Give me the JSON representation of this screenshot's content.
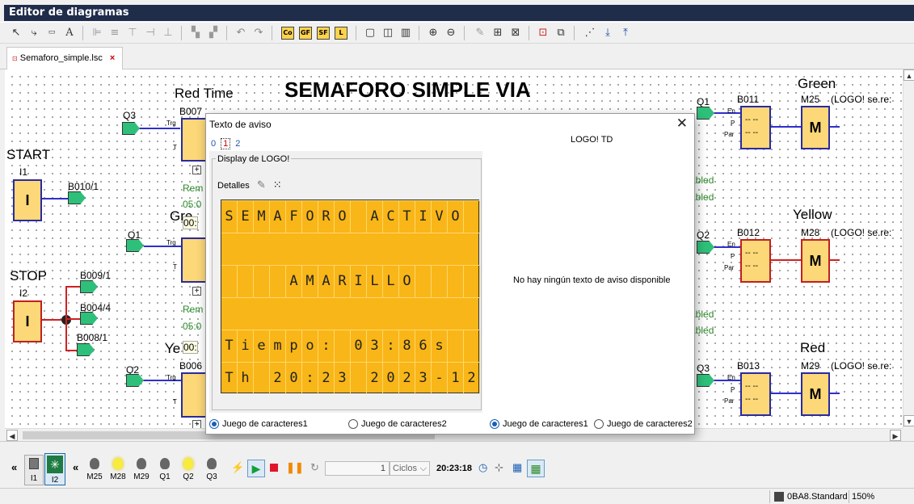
{
  "window": {
    "title": "Editor de diagramas"
  },
  "toolbar": {
    "items": [
      "select-arrow",
      "connect",
      "numeric",
      "text-A",
      "align-left",
      "align-center",
      "align-top",
      "align-middle",
      "align-bottom",
      "group",
      "ungroup",
      "undo",
      "redo",
      "Co",
      "GF",
      "SF",
      "L",
      "view-single",
      "view-double",
      "view-triple",
      "zoom-in",
      "zoom-out",
      "edit",
      "grid",
      "clear",
      "simulation",
      "network",
      "snap",
      "down",
      "up"
    ]
  },
  "tab": {
    "label": "Semaforo_simple.lsc",
    "close": "×"
  },
  "diagram": {
    "title": "SEMAFORO SIMPLE VIA",
    "labels": {
      "red_time": "Red Time",
      "green_l": "Green",
      "yellow_l": "Yellow",
      "red_r": "Red",
      "green_mid": "Gre",
      "yellow_mid": "Ye",
      "start": "START",
      "stop": "STOP",
      "i1": "I1",
      "i2": "I2",
      "q3a": "Q3",
      "q1a": "Q1",
      "q2a": "Q2",
      "q1b": "Q1",
      "q2b": "Q2",
      "q3b": "Q3",
      "b007": "B007",
      "b010": "B010/1",
      "b009": "B009/1",
      "b004": "B004/4",
      "b008": "B008/1",
      "b006": "B006",
      "b011": "B011",
      "b012": "B012",
      "b013": "B013",
      "m25": "M25",
      "m28": "M28",
      "m29": "M29",
      "logo_se": "(LOGO! se.re:",
      "rem1": "Rem",
      "rem2": "Rem",
      "t1": "05:0",
      "t2": "05:0",
      "t3": "00:",
      "t4": "00:",
      "enabled1": "abled",
      "enabled2": "abled",
      "enabled3": "abled",
      "enabled4": "abled",
      "trg": "Trg",
      "t": "T",
      "en": "En",
      "p": "P",
      "par": "Par",
      "m": "M",
      "i": "I",
      "dash": "-- --"
    }
  },
  "dialog": {
    "title": "Texto de aviso",
    "close": "✕",
    "tabs": [
      "0",
      "1",
      "2"
    ],
    "group_title": "Display de LOGO!",
    "details": "Detalles",
    "device": "LOGO! TD",
    "no_message": "No hay ningún texto de aviso disponible",
    "lcd_rows": [
      "SEMAFORO ACTIVO",
      "AMARILLO",
      "Tiempo: 03:86s",
      "Th 20:23 2023-12"
    ],
    "radio_left": [
      "Juego de caracteres1",
      "Juego de caracteres2"
    ],
    "radio_right": [
      "Juego de caracteres1",
      "Juego de caracteres2"
    ]
  },
  "sim": {
    "inputs": [
      {
        "label": "I1"
      },
      {
        "label": "I2"
      }
    ],
    "outputs": [
      {
        "label": "M25",
        "on": false
      },
      {
        "label": "M28",
        "on": true
      },
      {
        "label": "M29",
        "on": false
      },
      {
        "label": "Q1",
        "on": false
      },
      {
        "label": "Q2",
        "on": true
      },
      {
        "label": "Q3",
        "on": false
      }
    ],
    "counter": "1",
    "unit": "Ciclos",
    "time": "20:23:18"
  },
  "status": {
    "device": "0BA8.Standard",
    "zoom": "150%"
  }
}
